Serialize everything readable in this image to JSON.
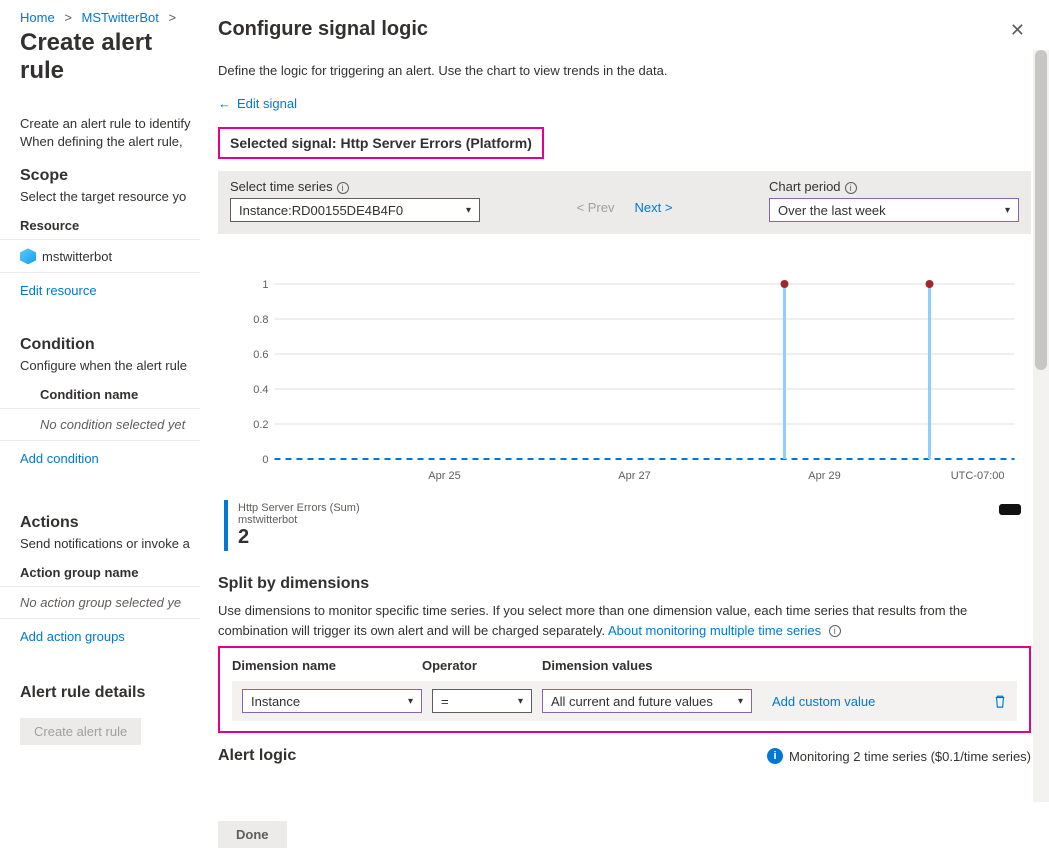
{
  "breadcrumb": {
    "home": "Home",
    "item": "MSTwitterBot"
  },
  "page_title": "Create alert rule",
  "left": {
    "intro": "Create an alert rule to identify \nWhen defining the alert rule,",
    "scope_h": "Scope",
    "scope_desc": "Select the target resource yo",
    "resource_col": "Resource",
    "resource_name": "mstwitterbot",
    "edit_resource": "Edit resource",
    "condition_h": "Condition",
    "condition_desc": "Configure when the alert rule",
    "condition_col": "Condition name",
    "condition_none": "No condition selected yet",
    "add_condition": "Add condition",
    "actions_h": "Actions",
    "actions_desc": "Send notifications or invoke a",
    "action_col": "Action group name",
    "action_none": "No action group selected ye",
    "add_action": "Add action groups",
    "details_h": "Alert rule details",
    "create_btn": "Create alert rule"
  },
  "panel": {
    "title": "Configure signal logic",
    "sub": "Define the logic for triggering an alert. Use the chart to view trends in the data.",
    "edit_signal": "Edit signal",
    "selected_prefix": "Selected signal: ",
    "selected_signal": "Http Server Errors (Platform)",
    "timeseries_label": "Select time series",
    "timeseries_value": "Instance:RD00155DE4B4F0",
    "prev": "< Prev",
    "next": "Next >",
    "chart_period_label": "Chart period",
    "chart_period_value": "Over the last week",
    "legend_title": "Http Server Errors (Sum)",
    "legend_sub": "mstwitterbot",
    "legend_value": "2",
    "dim_h": "Split by dimensions",
    "dim_desc": "Use dimensions to monitor specific time series. If you select more than one dimension value, each time series that results from the combination will trigger its own alert and will be charged separately. ",
    "dim_link": "About monitoring multiple time series",
    "dim_cols": {
      "c1": "Dimension name",
      "c2": "Operator",
      "c3": "Dimension values"
    },
    "dim_row": {
      "name": "Instance",
      "op": "=",
      "val": "All current and future values",
      "add": "Add custom value"
    },
    "alert_logic": "Alert logic",
    "monitoring": "Monitoring 2 time series ($0.1/time series)",
    "done": "Done",
    "tz": "UTC-07:00"
  },
  "chart_data": {
    "type": "line",
    "title": "Http Server Errors (Sum)",
    "ylabel": "",
    "ylim": [
      0,
      1
    ],
    "yticks": [
      0,
      0.2,
      0.4,
      0.6,
      0.8,
      1
    ],
    "x_ticks": [
      "Apr 25",
      "Apr 27",
      "Apr 29"
    ],
    "x": [
      0,
      1,
      2,
      3,
      4,
      5,
      6,
      7,
      8
    ],
    "values": [
      0,
      0,
      0,
      0,
      0,
      0,
      1,
      0,
      1
    ],
    "spike_positions": [
      6.4,
      8.1
    ]
  }
}
